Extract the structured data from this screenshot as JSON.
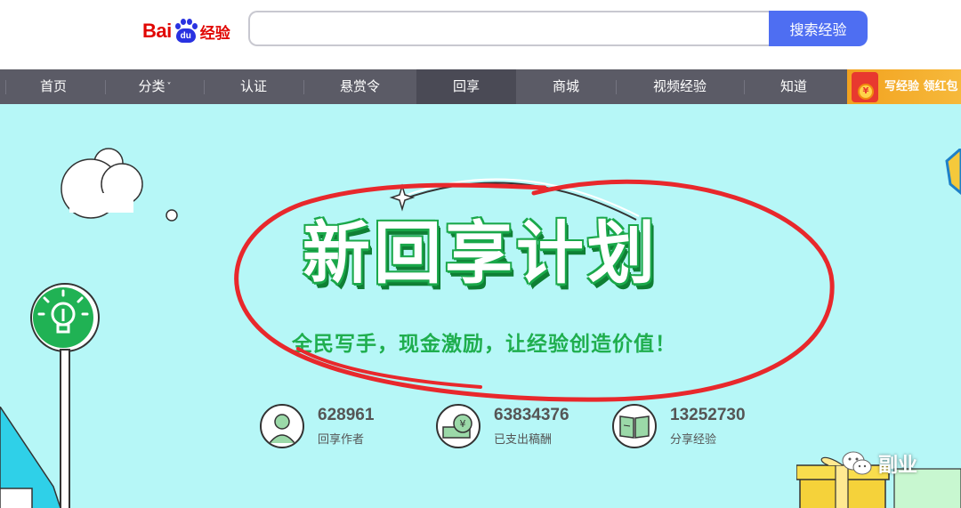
{
  "header": {
    "logo_bai": "Bai",
    "logo_du": "du",
    "logo_text": "经验",
    "search_placeholder": "",
    "search_button": "搜索经验"
  },
  "nav": {
    "items": [
      {
        "label": "首页"
      },
      {
        "label": "分类"
      },
      {
        "label": "认证"
      },
      {
        "label": "悬赏令"
      },
      {
        "label": "回享"
      },
      {
        "label": "商城"
      },
      {
        "label": "视频经验"
      },
      {
        "label": "知道"
      }
    ],
    "category_caret": "˅",
    "promo_text": "写经验 领红包",
    "promo_coin": "¥"
  },
  "banner": {
    "title": "新回享计划",
    "subtitle": "全民写手，现金激励，让经验创造价值！",
    "stats": [
      {
        "number": "628961",
        "label": "回享作者",
        "icon": "author-icon"
      },
      {
        "number": "63834376",
        "label": "已支出稿酬",
        "icon": "money-icon"
      },
      {
        "number": "13252730",
        "label": "分享经验",
        "icon": "book-icon"
      }
    ]
  },
  "watermark": {
    "text": "副业"
  },
  "colors": {
    "search_blue": "#4e6ef2",
    "nav_bg": "#5b5b66",
    "banner_bg": "#b6f7f7",
    "green": "#1fae4e",
    "annotation_red": "#e8282c",
    "baidu_red": "#e10602"
  }
}
